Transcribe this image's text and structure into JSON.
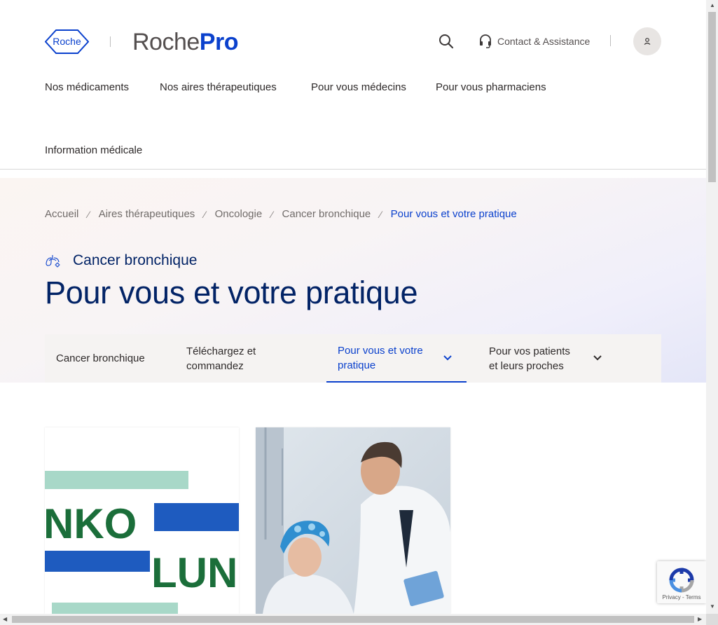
{
  "header": {
    "roche_logo_text": "Roche",
    "brand_part1": "Roche",
    "brand_part2": "Pro",
    "contact_label": "Contact & Assistance"
  },
  "main_nav": [
    {
      "label": "Nos médicaments"
    },
    {
      "label": "Nos aires thérapeutiques"
    },
    {
      "label": "Pour vous médecins"
    },
    {
      "label": "Pour vous pharmaciens"
    },
    {
      "label": "Information médicale"
    }
  ],
  "breadcrumb": [
    {
      "label": "Accueil"
    },
    {
      "label": "Aires thérapeutiques"
    },
    {
      "label": "Oncologie"
    },
    {
      "label": "Cancer bronchique"
    },
    {
      "label": "Pour vous et votre pratique"
    }
  ],
  "breadcrumb_separator": "⁄",
  "hero": {
    "area_label": "Cancer bronchique",
    "title": "Pour vous et votre pratique"
  },
  "subnav": [
    {
      "line1": "Cancer bronchique",
      "line2": ""
    },
    {
      "line1": "Téléchargez et",
      "line2": "commandez"
    },
    {
      "line1": "Pour vous et votre",
      "line2": "pratique"
    },
    {
      "line1": "Pour vos patients",
      "line2": "et leurs proches"
    }
  ],
  "cards": [
    {
      "image_text_top": "NKO",
      "image_text_bottom": "LUN"
    },
    {
      "image_alt": "doctor-with-patient-photo"
    }
  ],
  "recaptcha": {
    "privacy": "Privacy",
    "separator": "-",
    "terms": "Terms"
  },
  "colors": {
    "brand_blue": "#0b41cd",
    "title_navy": "#022366",
    "text_grey": "#544f4f"
  }
}
